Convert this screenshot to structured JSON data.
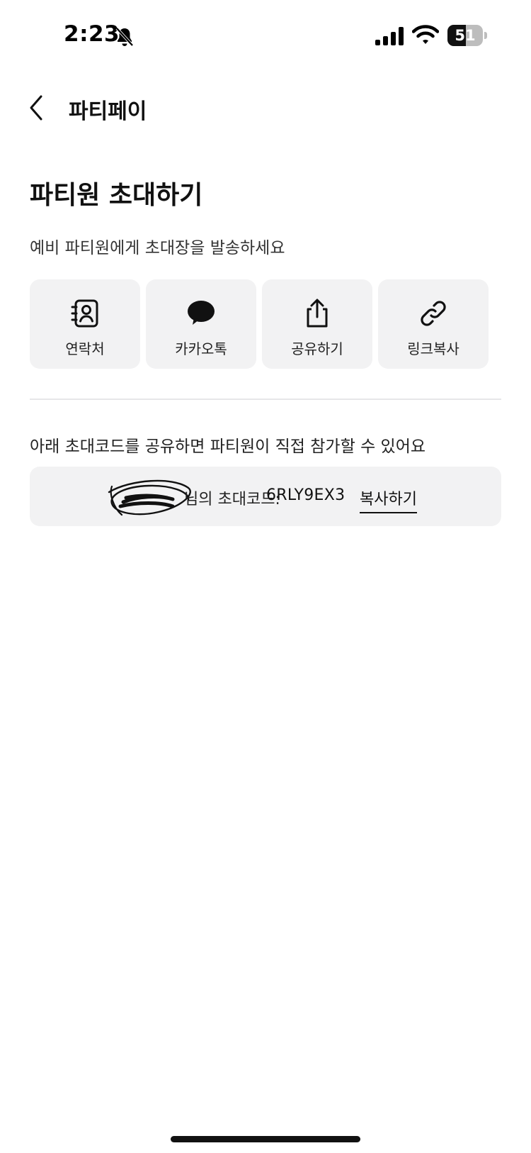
{
  "status_bar": {
    "time": "2:23",
    "battery_level": "51",
    "battery_fraction": 0.51,
    "icons": [
      "bell-off-icon",
      "signal-icon",
      "wifi-icon",
      "battery-icon"
    ]
  },
  "nav": {
    "back_icon": "chevron-left-icon",
    "title": "파티페이"
  },
  "invite": {
    "title": "파티원 초대하기",
    "subtitle": "예비 파티원에게 초대장을 발송하세요",
    "share_options": [
      {
        "label": "연락처",
        "icon": "contacts-icon"
      },
      {
        "label": "카카오톡",
        "icon": "kakaotalk-icon"
      },
      {
        "label": "공유하기",
        "icon": "share-icon"
      },
      {
        "label": "링크복사",
        "icon": "link-icon"
      }
    ]
  },
  "code_section": {
    "description": "아래 초대코드를 공유하면 파티원이 직접 참가할 수 있어요",
    "owner_label": "님의 초대코드:",
    "code": "6RLY9EX3",
    "copy_label": "복사하기"
  },
  "colors": {
    "tile_background": "#f2f2f3",
    "text_primary": "#111111",
    "divider": "#e6e6e8"
  }
}
